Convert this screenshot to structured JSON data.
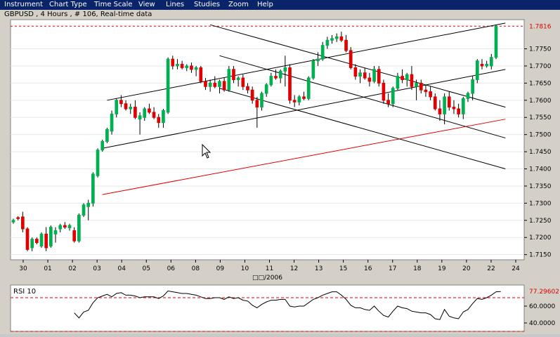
{
  "menu": [
    "Instrument",
    "Chart Type",
    "Time Scale",
    "View",
    "Lines",
    "Studies",
    "Zoom",
    "Help"
  ],
  "chart_title": "GBPUSD , 4 Hours , # 106, Real-time data",
  "x_axis_caption": "□□/2006",
  "colors": {
    "up": "#00b050",
    "down": "#e00000",
    "menu_bg": "#0a246a",
    "panel_bg": "#ffffff",
    "chrome": "#d4d0c8"
  },
  "chart_data": [
    {
      "type": "candlestick",
      "title": "GBPUSD , 4 Hours , # 106, Real-time data",
      "ylim": [
        1.7135,
        1.7835
      ],
      "yticks": [
        "1.7150",
        "1.7200",
        "1.7250",
        "1.7300",
        "1.7350",
        "1.7400",
        "1.7450",
        "1.7500",
        "1.7550",
        "1.7600",
        "1.7650",
        "1.7700",
        "1.7750"
      ],
      "last_price": "1.7816",
      "xticks": [
        "30",
        "01",
        "02",
        "03",
        "04",
        "05",
        "06",
        "08",
        "09",
        "10",
        "11",
        "12",
        "13",
        "15",
        "16",
        "17",
        "18",
        "19",
        "20",
        "22",
        "24"
      ],
      "candles": [
        {
          "o": 1.7245,
          "h": 1.7255,
          "l": 1.724,
          "c": 1.725
        },
        {
          "o": 1.7258,
          "h": 1.7262,
          "l": 1.725,
          "c": 1.7255
        },
        {
          "o": 1.726,
          "h": 1.7275,
          "l": 1.7215,
          "c": 1.7225
        },
        {
          "o": 1.7225,
          "h": 1.723,
          "l": 1.716,
          "c": 1.7165
        },
        {
          "o": 1.717,
          "h": 1.72,
          "l": 1.716,
          "c": 1.7195
        },
        {
          "o": 1.7195,
          "h": 1.72,
          "l": 1.718,
          "c": 1.7185
        },
        {
          "o": 1.7175,
          "h": 1.7215,
          "l": 1.717,
          "c": 1.721
        },
        {
          "o": 1.721,
          "h": 1.723,
          "l": 1.716,
          "c": 1.717
        },
        {
          "o": 1.7175,
          "h": 1.7235,
          "l": 1.717,
          "c": 1.723
        },
        {
          "o": 1.721,
          "h": 1.723,
          "l": 1.7185,
          "c": 1.722
        },
        {
          "o": 1.7225,
          "h": 1.724,
          "l": 1.7215,
          "c": 1.7235
        },
        {
          "o": 1.7235,
          "h": 1.7245,
          "l": 1.7225,
          "c": 1.723
        },
        {
          "o": 1.7228,
          "h": 1.724,
          "l": 1.722,
          "c": 1.7235
        },
        {
          "o": 1.722,
          "h": 1.723,
          "l": 1.7185,
          "c": 1.719
        },
        {
          "o": 1.719,
          "h": 1.727,
          "l": 1.7185,
          "c": 1.7265
        },
        {
          "o": 1.7265,
          "h": 1.73,
          "l": 1.726,
          "c": 1.7295
        },
        {
          "o": 1.729,
          "h": 1.731,
          "l": 1.725,
          "c": 1.73
        },
        {
          "o": 1.73,
          "h": 1.739,
          "l": 1.729,
          "c": 1.7385
        },
        {
          "o": 1.738,
          "h": 1.746,
          "l": 1.7375,
          "c": 1.7455
        },
        {
          "o": 1.7455,
          "h": 1.7485,
          "l": 1.745,
          "c": 1.748
        },
        {
          "o": 1.748,
          "h": 1.752,
          "l": 1.7475,
          "c": 1.7515
        },
        {
          "o": 1.751,
          "h": 1.757,
          "l": 1.75,
          "c": 1.756
        },
        {
          "o": 1.756,
          "h": 1.7605,
          "l": 1.755,
          "c": 1.76
        },
        {
          "o": 1.76,
          "h": 1.7615,
          "l": 1.758,
          "c": 1.759
        },
        {
          "o": 1.759,
          "h": 1.76,
          "l": 1.757,
          "c": 1.7575
        },
        {
          "o": 1.7575,
          "h": 1.759,
          "l": 1.756,
          "c": 1.758
        },
        {
          "o": 1.758,
          "h": 1.76,
          "l": 1.7545,
          "c": 1.755
        },
        {
          "o": 1.7545,
          "h": 1.7565,
          "l": 1.75,
          "c": 1.7555
        },
        {
          "o": 1.755,
          "h": 1.758,
          "l": 1.754,
          "c": 1.7575
        },
        {
          "o": 1.7575,
          "h": 1.759,
          "l": 1.756,
          "c": 1.7565
        },
        {
          "o": 1.7565,
          "h": 1.758,
          "l": 1.7545,
          "c": 1.755
        },
        {
          "o": 1.755,
          "h": 1.756,
          "l": 1.752,
          "c": 1.7535
        },
        {
          "o": 1.7535,
          "h": 1.7575,
          "l": 1.752,
          "c": 1.757
        },
        {
          "o": 1.7565,
          "h": 1.7725,
          "l": 1.756,
          "c": 1.772
        },
        {
          "o": 1.772,
          "h": 1.773,
          "l": 1.769,
          "c": 1.77
        },
        {
          "o": 1.77,
          "h": 1.772,
          "l": 1.769,
          "c": 1.7705
        },
        {
          "o": 1.7705,
          "h": 1.7715,
          "l": 1.769,
          "c": 1.7695
        },
        {
          "o": 1.7695,
          "h": 1.7705,
          "l": 1.7685,
          "c": 1.77
        },
        {
          "o": 1.77,
          "h": 1.771,
          "l": 1.768,
          "c": 1.769
        },
        {
          "o": 1.769,
          "h": 1.77,
          "l": 1.767,
          "c": 1.7695
        },
        {
          "o": 1.7695,
          "h": 1.77,
          "l": 1.765,
          "c": 1.7655
        },
        {
          "o": 1.7655,
          "h": 1.7665,
          "l": 1.763,
          "c": 1.764
        },
        {
          "o": 1.764,
          "h": 1.766,
          "l": 1.7625,
          "c": 1.765
        },
        {
          "o": 1.765,
          "h": 1.767,
          "l": 1.7635,
          "c": 1.764
        },
        {
          "o": 1.764,
          "h": 1.766,
          "l": 1.762,
          "c": 1.7655
        },
        {
          "o": 1.7655,
          "h": 1.7665,
          "l": 1.7625,
          "c": 1.763
        },
        {
          "o": 1.763,
          "h": 1.77,
          "l": 1.7625,
          "c": 1.769
        },
        {
          "o": 1.769,
          "h": 1.77,
          "l": 1.765,
          "c": 1.766
        },
        {
          "o": 1.766,
          "h": 1.767,
          "l": 1.764,
          "c": 1.7665
        },
        {
          "o": 1.7665,
          "h": 1.7675,
          "l": 1.763,
          "c": 1.764
        },
        {
          "o": 1.764,
          "h": 1.765,
          "l": 1.762,
          "c": 1.763
        },
        {
          "o": 1.763,
          "h": 1.764,
          "l": 1.759,
          "c": 1.76
        },
        {
          "o": 1.76,
          "h": 1.761,
          "l": 1.752,
          "c": 1.758
        },
        {
          "o": 1.758,
          "h": 1.7625,
          "l": 1.757,
          "c": 1.762
        },
        {
          "o": 1.762,
          "h": 1.765,
          "l": 1.761,
          "c": 1.7645
        },
        {
          "o": 1.7645,
          "h": 1.768,
          "l": 1.764,
          "c": 1.767
        },
        {
          "o": 1.767,
          "h": 1.769,
          "l": 1.766,
          "c": 1.7665
        },
        {
          "o": 1.7665,
          "h": 1.769,
          "l": 1.765,
          "c": 1.7685
        },
        {
          "o": 1.7685,
          "h": 1.773,
          "l": 1.764,
          "c": 1.7695
        },
        {
          "o": 1.7695,
          "h": 1.7705,
          "l": 1.759,
          "c": 1.76
        },
        {
          "o": 1.76,
          "h": 1.7615,
          "l": 1.758,
          "c": 1.7595
        },
        {
          "o": 1.7595,
          "h": 1.7615,
          "l": 1.7585,
          "c": 1.761
        },
        {
          "o": 1.761,
          "h": 1.7625,
          "l": 1.76,
          "c": 1.7605
        },
        {
          "o": 1.7605,
          "h": 1.767,
          "l": 1.76,
          "c": 1.7665
        },
        {
          "o": 1.7665,
          "h": 1.772,
          "l": 1.766,
          "c": 1.7715
        },
        {
          "o": 1.7715,
          "h": 1.774,
          "l": 1.77,
          "c": 1.772
        },
        {
          "o": 1.772,
          "h": 1.777,
          "l": 1.7715,
          "c": 1.776
        },
        {
          "o": 1.776,
          "h": 1.7785,
          "l": 1.775,
          "c": 1.7775
        },
        {
          "o": 1.7775,
          "h": 1.779,
          "l": 1.7765,
          "c": 1.778
        },
        {
          "o": 1.778,
          "h": 1.7795,
          "l": 1.777,
          "c": 1.7785
        },
        {
          "o": 1.7785,
          "h": 1.78,
          "l": 1.777,
          "c": 1.7775
        },
        {
          "o": 1.7775,
          "h": 1.779,
          "l": 1.774,
          "c": 1.7745
        },
        {
          "o": 1.7745,
          "h": 1.7755,
          "l": 1.769,
          "c": 1.7695
        },
        {
          "o": 1.7695,
          "h": 1.7705,
          "l": 1.766,
          "c": 1.767
        },
        {
          "o": 1.767,
          "h": 1.769,
          "l": 1.765,
          "c": 1.768
        },
        {
          "o": 1.768,
          "h": 1.7695,
          "l": 1.766,
          "c": 1.7665
        },
        {
          "o": 1.7665,
          "h": 1.768,
          "l": 1.764,
          "c": 1.7655
        },
        {
          "o": 1.7655,
          "h": 1.77,
          "l": 1.765,
          "c": 1.769
        },
        {
          "o": 1.769,
          "h": 1.77,
          "l": 1.764,
          "c": 1.765
        },
        {
          "o": 1.765,
          "h": 1.766,
          "l": 1.759,
          "c": 1.76
        },
        {
          "o": 1.76,
          "h": 1.762,
          "l": 1.758,
          "c": 1.759
        },
        {
          "o": 1.759,
          "h": 1.764,
          "l": 1.758,
          "c": 1.7635
        },
        {
          "o": 1.7635,
          "h": 1.768,
          "l": 1.763,
          "c": 1.767
        },
        {
          "o": 1.767,
          "h": 1.769,
          "l": 1.765,
          "c": 1.766
        },
        {
          "o": 1.766,
          "h": 1.768,
          "l": 1.764,
          "c": 1.7675
        },
        {
          "o": 1.7675,
          "h": 1.77,
          "l": 1.763,
          "c": 1.764
        },
        {
          "o": 1.764,
          "h": 1.766,
          "l": 1.76,
          "c": 1.765
        },
        {
          "o": 1.765,
          "h": 1.766,
          "l": 1.762,
          "c": 1.763
        },
        {
          "o": 1.763,
          "h": 1.7645,
          "l": 1.761,
          "c": 1.7625
        },
        {
          "o": 1.7625,
          "h": 1.764,
          "l": 1.76,
          "c": 1.761
        },
        {
          "o": 1.761,
          "h": 1.762,
          "l": 1.757,
          "c": 1.7575
        },
        {
          "o": 1.7575,
          "h": 1.76,
          "l": 1.754,
          "c": 1.756
        },
        {
          "o": 1.756,
          "h": 1.762,
          "l": 1.753,
          "c": 1.761
        },
        {
          "o": 1.761,
          "h": 1.7625,
          "l": 1.757,
          "c": 1.758
        },
        {
          "o": 1.758,
          "h": 1.76,
          "l": 1.756,
          "c": 1.7575
        },
        {
          "o": 1.7575,
          "h": 1.759,
          "l": 1.755,
          "c": 1.756
        },
        {
          "o": 1.756,
          "h": 1.761,
          "l": 1.7545,
          "c": 1.7605
        },
        {
          "o": 1.7605,
          "h": 1.7625,
          "l": 1.7595,
          "c": 1.762
        },
        {
          "o": 1.762,
          "h": 1.767,
          "l": 1.76,
          "c": 1.766
        },
        {
          "o": 1.766,
          "h": 1.772,
          "l": 1.765,
          "c": 1.7715
        },
        {
          "o": 1.7705,
          "h": 1.772,
          "l": 1.769,
          "c": 1.77
        },
        {
          "o": 1.77,
          "h": 1.7715,
          "l": 1.7695,
          "c": 1.7705
        },
        {
          "o": 1.77,
          "h": 1.7735,
          "l": 1.769,
          "c": 1.7725
        },
        {
          "o": 1.7725,
          "h": 1.782,
          "l": 1.772,
          "c": 1.7816
        }
      ],
      "trendlines": [
        {
          "color": "#000000",
          "points": [
            [
              20,
              1.76
            ],
            [
              105,
              1.7825
            ]
          ]
        },
        {
          "color": "#000000",
          "points": [
            [
              19,
              1.746
            ],
            [
              105,
              1.769
            ]
          ]
        },
        {
          "color": "#000000",
          "points": [
            [
              42,
              1.782
            ],
            [
              105,
              1.758
            ]
          ]
        },
        {
          "color": "#000000",
          "points": [
            [
              44,
              1.773
            ],
            [
              105,
              1.749
            ]
          ]
        },
        {
          "color": "#000000",
          "points": [
            [
              44,
              1.7635
            ],
            [
              105,
              1.74
            ]
          ]
        },
        {
          "color": "#e00000",
          "points": [
            [
              19,
              1.7325
            ],
            [
              105,
              1.7545
            ]
          ]
        }
      ],
      "hlines": [
        {
          "y": 1.7816,
          "color": "#e00000",
          "style": "dashed"
        }
      ]
    },
    {
      "type": "line",
      "title": "RSI 10",
      "ylim": [
        30,
        85
      ],
      "yticks": [
        "60.0000",
        "40.0000"
      ],
      "last_label": "77.29602",
      "hlines": [
        {
          "y": 70,
          "color": "#e00000",
          "style": "dashed"
        },
        {
          "y": 30,
          "color": "#e00000",
          "style": "dashed"
        }
      ],
      "values": [
        null,
        null,
        null,
        null,
        null,
        null,
        null,
        null,
        null,
        null,
        null,
        null,
        null,
        52,
        46,
        53,
        55,
        64,
        70,
        72,
        74,
        71,
        75,
        76,
        73,
        73,
        72,
        70,
        71,
        71,
        71,
        69,
        72,
        78,
        77,
        76,
        75,
        75,
        74,
        73,
        71,
        69,
        69,
        70,
        70,
        68,
        71,
        69,
        70,
        67,
        66,
        61,
        58,
        62,
        65,
        67,
        67,
        68,
        68,
        60,
        59,
        60,
        60,
        64,
        68,
        70,
        73,
        75,
        77,
        77,
        73,
        68,
        61,
        58,
        58,
        56,
        55,
        60,
        54,
        49,
        47,
        54,
        60,
        58,
        57,
        54,
        53,
        52,
        52,
        50,
        45,
        44,
        56,
        48,
        46,
        45,
        53,
        56,
        63,
        69,
        68,
        70,
        73,
        77,
        77.3
      ]
    }
  ]
}
